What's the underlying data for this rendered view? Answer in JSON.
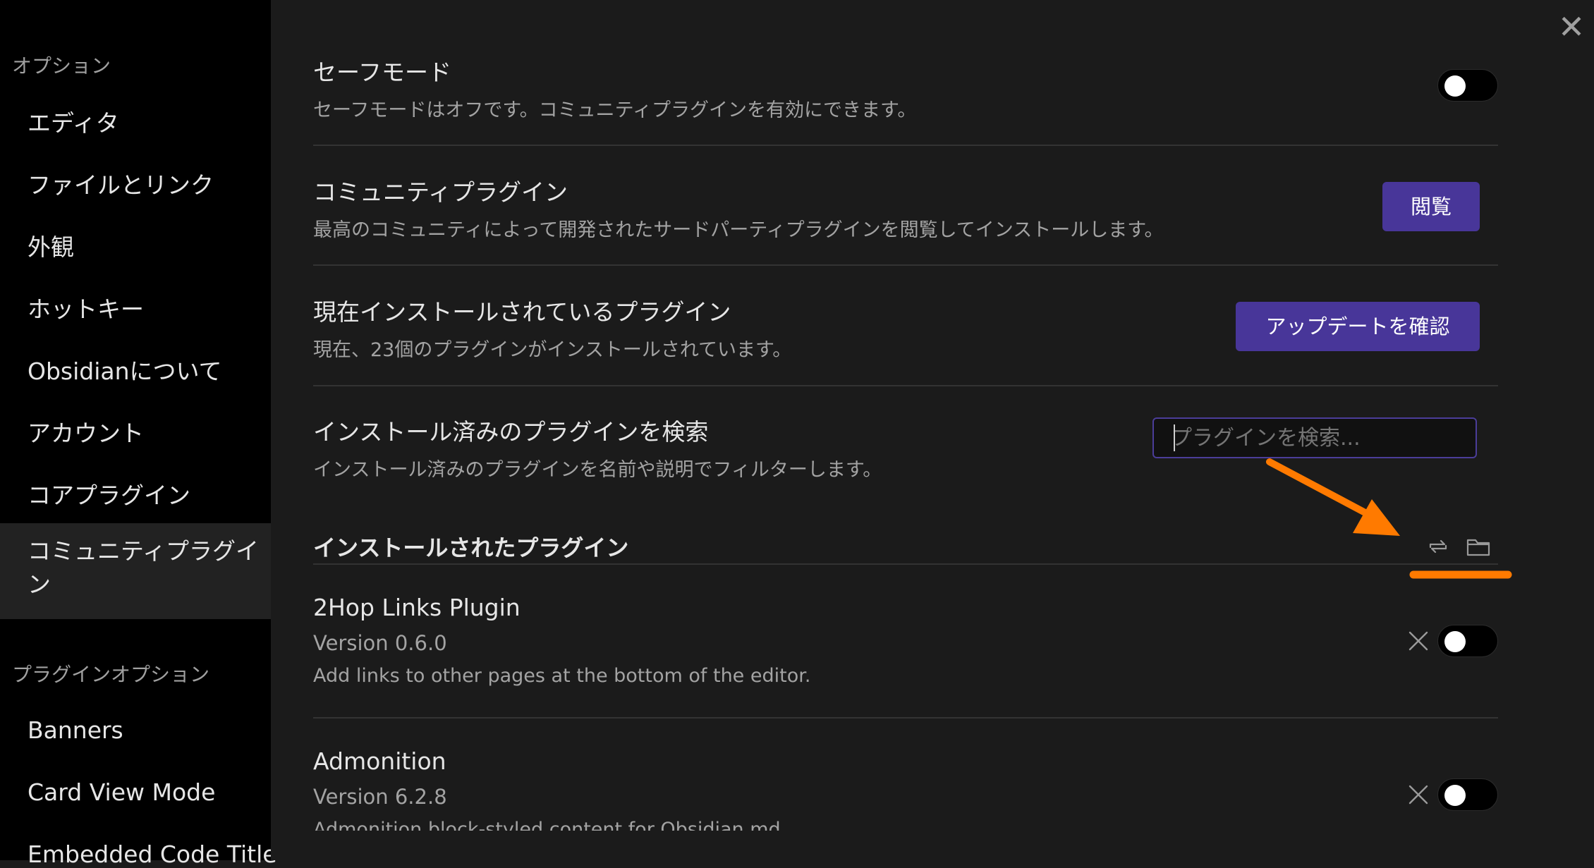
{
  "sidebar": {
    "options_heading": "オプション",
    "items": [
      {
        "label": "エディタ"
      },
      {
        "label": "ファイルとリンク"
      },
      {
        "label": "外観"
      },
      {
        "label": "ホットキー"
      },
      {
        "label": "Obsidianについて"
      },
      {
        "label": "アカウント"
      },
      {
        "label": "コアプラグイン"
      }
    ],
    "active_item": "コミュニティプラグイン",
    "plugin_options_heading": "プラグインオプション",
    "plugin_items": [
      {
        "label": "Banners"
      },
      {
        "label": "Card View Mode"
      },
      {
        "label": "Embedded Code Title"
      }
    ]
  },
  "settings": {
    "safe_mode": {
      "title": "セーフモード",
      "description": "セーフモードはオフです。コミュニティプラグインを有効にできます。"
    },
    "community": {
      "title": "コミュニティプラグイン",
      "description": "最高のコミュニティによって開発されたサードパーティプラグインを閲覧してインストールします。",
      "button": "閲覧"
    },
    "installed": {
      "title": "現在インストールされているプラグイン",
      "description": "現在、23個のプラグインがインストールされています。",
      "button": "アップデートを確認"
    },
    "search": {
      "title": "インストール済みのプラグインを検索",
      "description": "インストール済みのプラグインを名前や説明でフィルターします。",
      "placeholder": "プラグインを検索..."
    }
  },
  "installed_section": {
    "title": "インストールされたプラグイン",
    "reload_icon": "reload-icon",
    "folder_icon": "folder-icon"
  },
  "plugins": [
    {
      "name": "2Hop Links Plugin",
      "version": "Version 0.6.0",
      "description": "Add links to other pages at the bottom of the editor.",
      "enabled": false
    },
    {
      "name": "Admonition",
      "version": "Version 6.2.8",
      "description": "Admonition block-styled content for Obsidian.md",
      "enabled": false
    }
  ],
  "colors": {
    "accent": "#483699",
    "annotation": "#ff7a00"
  }
}
